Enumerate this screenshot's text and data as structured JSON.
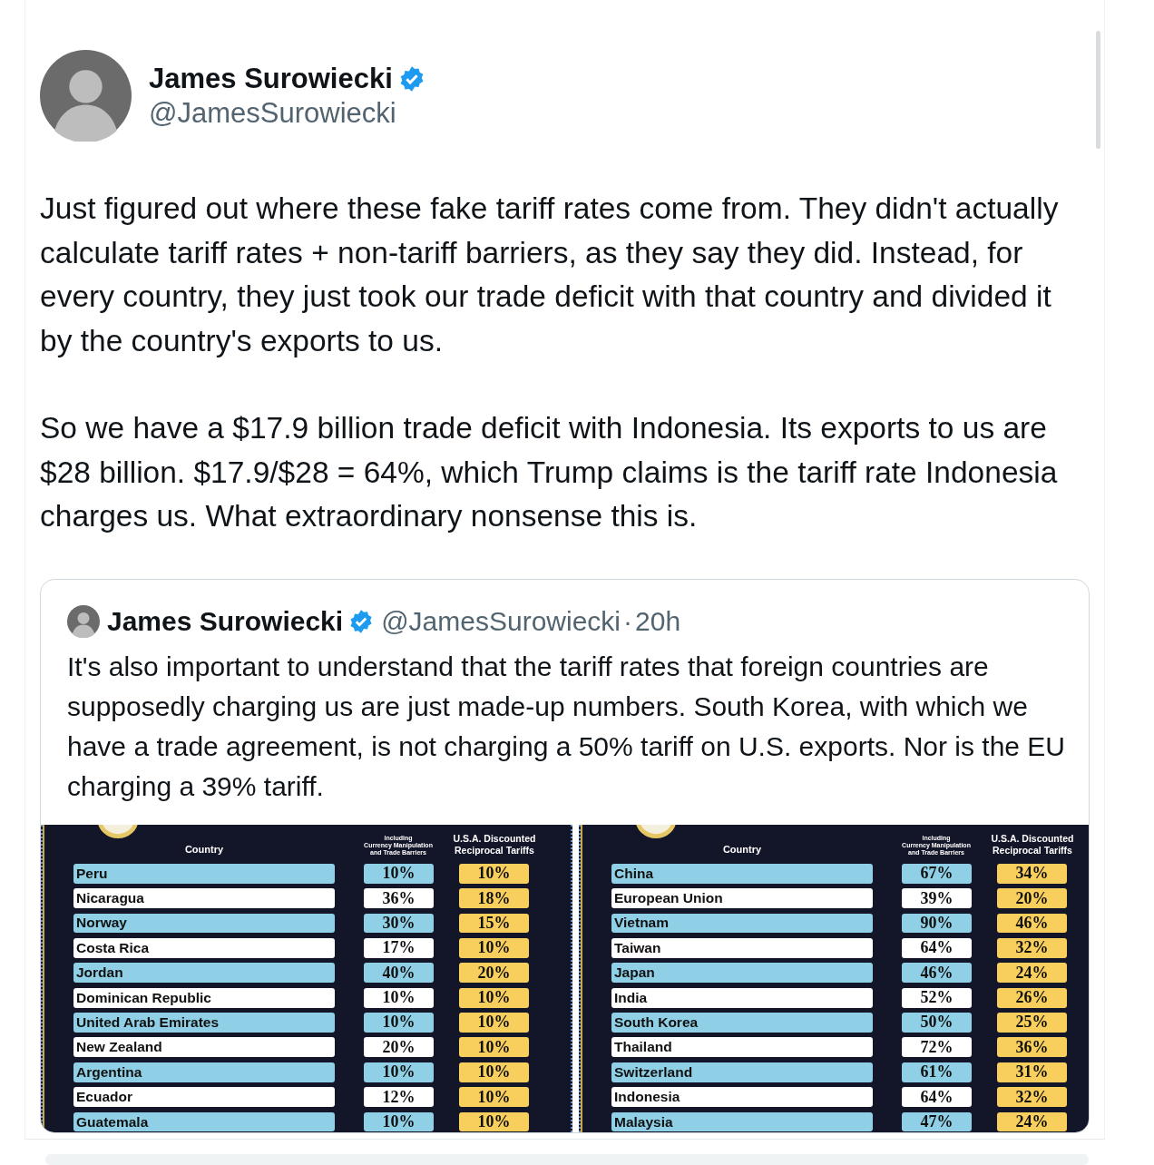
{
  "author": {
    "name": "James Surowiecki",
    "handle": "@JamesSurowiecki",
    "verified": true
  },
  "paragraphs": [
    "Just figured out where these fake tariff rates come from. They didn't actually calculate tariff rates + non-tariff barriers, as they say they did. Instead, for every country, they just took our trade deficit with that country and divided it by the country's exports to us.",
    "So we have a $17.9 billion trade deficit with Indonesia. Its exports to us are $28 billion. $17.9/$28 = 64%, which Trump claims is the tariff rate Indonesia charges us. What extraordinary nonsense this is."
  ],
  "quote": {
    "name": "James Surowiecki",
    "verified": true,
    "handle": "@JamesSurowiecki",
    "separator": "·",
    "time": "20h",
    "text": "It's also important to understand that the tariff rates that foreign countries are supposedly charging us are just made-up numbers. South Korea, with which we have a trade agreement, is not charging a 50% tariff on U.S. exports. Nor is the EU charging a 39% tariff.",
    "panels": [
      {
        "headers": {
          "country": "Country",
          "rate_lines": [
            "Including",
            "Currency Manipulation",
            "and Trade Barriers"
          ],
          "tariff_lines": [
            "U.S.A. Discounted",
            "Reciprocal Tariffs"
          ]
        },
        "rows": [
          {
            "country": "Peru",
            "rate": "10%",
            "tariff": "10%",
            "shaded": true
          },
          {
            "country": "Nicaragua",
            "rate": "36%",
            "tariff": "18%",
            "shaded": false
          },
          {
            "country": "Norway",
            "rate": "30%",
            "tariff": "15%",
            "shaded": true
          },
          {
            "country": "Costa Rica",
            "rate": "17%",
            "tariff": "10%",
            "shaded": false
          },
          {
            "country": "Jordan",
            "rate": "40%",
            "tariff": "20%",
            "shaded": true
          },
          {
            "country": "Dominican Republic",
            "rate": "10%",
            "tariff": "10%",
            "shaded": false
          },
          {
            "country": "United Arab Emirates",
            "rate": "10%",
            "tariff": "10%",
            "shaded": true
          },
          {
            "country": "New Zealand",
            "rate": "20%",
            "tariff": "10%",
            "shaded": false
          },
          {
            "country": "Argentina",
            "rate": "10%",
            "tariff": "10%",
            "shaded": true
          },
          {
            "country": "Ecuador",
            "rate": "12%",
            "tariff": "10%",
            "shaded": false
          },
          {
            "country": "Guatemala",
            "rate": "10%",
            "tariff": "10%",
            "shaded": true
          }
        ]
      },
      {
        "headers": {
          "country": "Country",
          "rate_lines": [
            "Including",
            "Currency Manipulation",
            "and Trade Barriers"
          ],
          "tariff_lines": [
            "U.S.A. Discounted",
            "Reciprocal Tariffs"
          ]
        },
        "rows": [
          {
            "country": "China",
            "rate": "67%",
            "tariff": "34%",
            "shaded": true
          },
          {
            "country": "European Union",
            "rate": "39%",
            "tariff": "20%",
            "shaded": false
          },
          {
            "country": "Vietnam",
            "rate": "90%",
            "tariff": "46%",
            "shaded": true
          },
          {
            "country": "Taiwan",
            "rate": "64%",
            "tariff": "32%",
            "shaded": false
          },
          {
            "country": "Japan",
            "rate": "46%",
            "tariff": "24%",
            "shaded": true
          },
          {
            "country": "India",
            "rate": "52%",
            "tariff": "26%",
            "shaded": false
          },
          {
            "country": "South Korea",
            "rate": "50%",
            "tariff": "25%",
            "shaded": true
          },
          {
            "country": "Thailand",
            "rate": "72%",
            "tariff": "36%",
            "shaded": false
          },
          {
            "country": "Switzerland",
            "rate": "61%",
            "tariff": "31%",
            "shaded": true
          },
          {
            "country": "Indonesia",
            "rate": "64%",
            "tariff": "32%",
            "shaded": false
          },
          {
            "country": "Malaysia",
            "rate": "47%",
            "tariff": "24%",
            "shaded": true
          }
        ]
      }
    ]
  }
}
